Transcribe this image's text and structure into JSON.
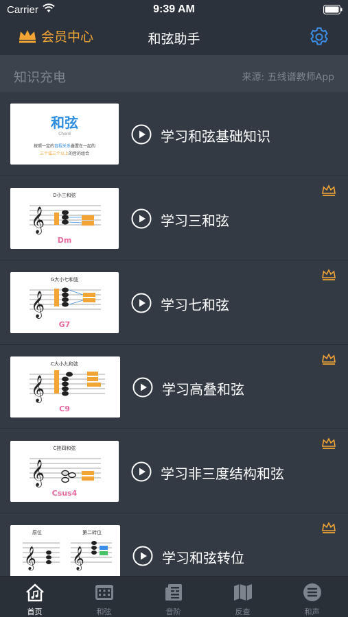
{
  "status_bar": {
    "carrier": "Carrier",
    "time": "9:39 AM"
  },
  "nav": {
    "vip_label": "会员中心",
    "title": "和弦助手"
  },
  "section": {
    "title": "知识充电",
    "source": "来源: 五线谱教师App"
  },
  "lessons": [
    {
      "title": "学习和弦基础知识",
      "premium": false,
      "thumb": {
        "title_zh": "和弦",
        "title_en": "Chord",
        "line1_a": "按照一定的",
        "line1_b": "音程关系",
        "line1_c": "叠置在一起的",
        "line2_a": "三个或三个以上",
        "line2_b": "的音的组合"
      }
    },
    {
      "title": "学习三和弦",
      "premium": true,
      "thumb": {
        "caption": "D小三和弦",
        "chord": "Dm"
      }
    },
    {
      "title": "学习七和弦",
      "premium": true,
      "thumb": {
        "caption": "G大小七和弦",
        "chord": "G7"
      }
    },
    {
      "title": "学习高叠和弦",
      "premium": true,
      "thumb": {
        "caption": "C大小九和弦",
        "chord": "C9"
      }
    },
    {
      "title": "学习非三度结构和弦",
      "premium": true,
      "thumb": {
        "caption": "C挂四和弦",
        "chord": "Csus4"
      }
    },
    {
      "title": "学习和弦转位",
      "premium": true,
      "thumb": {
        "caption_left": "原位",
        "caption_right": "第二转位"
      }
    }
  ],
  "tabs": [
    {
      "label": "首页",
      "icon": "home-music-icon",
      "active": true
    },
    {
      "label": "和弦",
      "icon": "keyboard-icon",
      "active": false
    },
    {
      "label": "音阶",
      "icon": "scale-list-icon",
      "active": false
    },
    {
      "label": "反查",
      "icon": "map-icon",
      "active": false
    },
    {
      "label": "和声",
      "icon": "list-circle-icon",
      "active": false
    }
  ],
  "colors": {
    "accent": "#f2a535",
    "settings_blue": "#3a8ee6",
    "background": "#333a44",
    "nav": "#2c323b"
  }
}
